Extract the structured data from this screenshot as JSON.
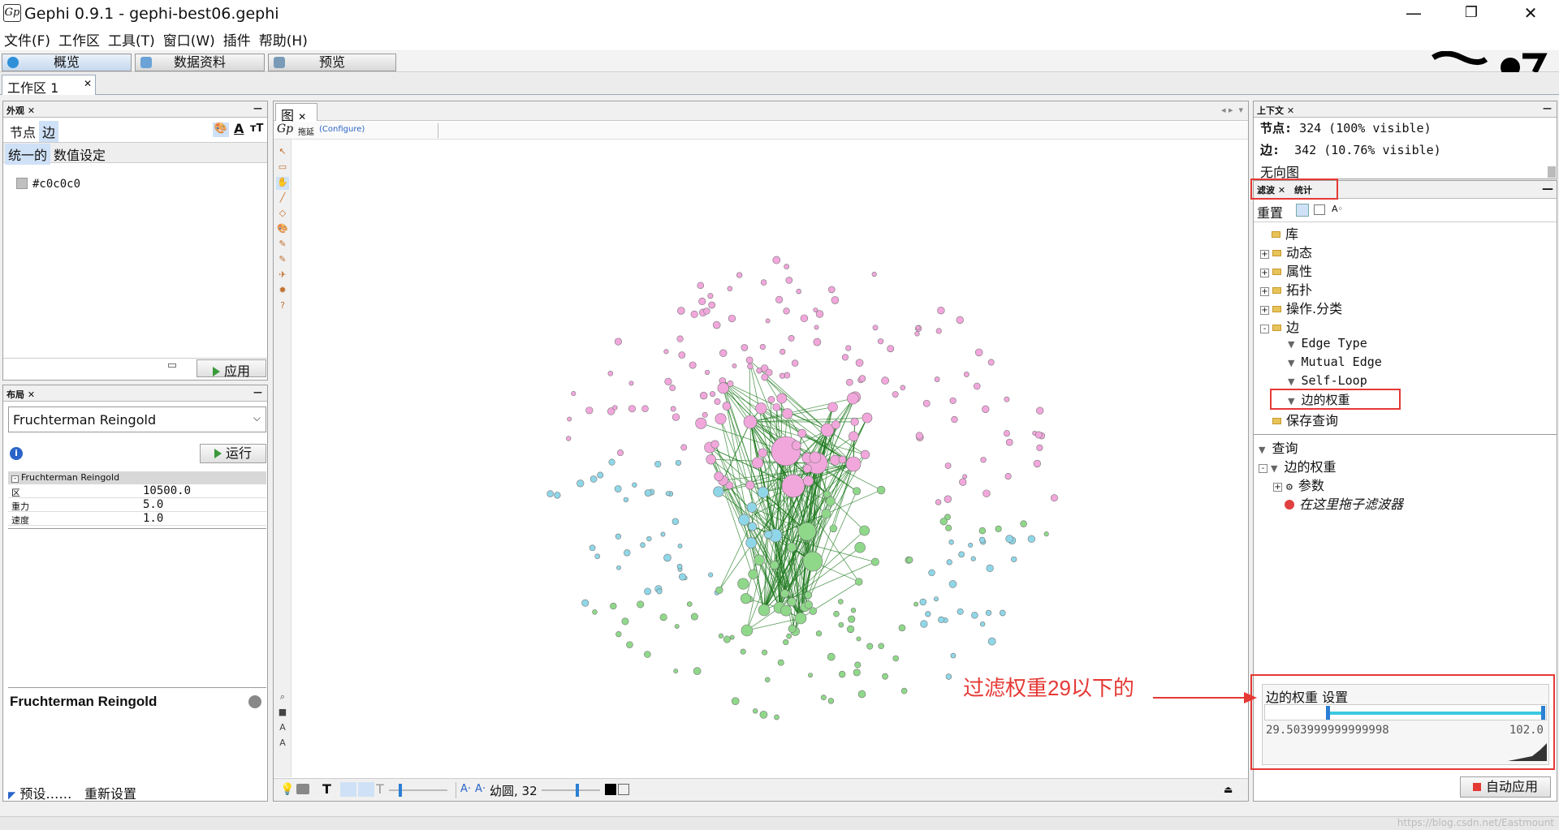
{
  "window": {
    "title": "Gephi 0.9.1 - gephi-best06.gephi",
    "app_icon": "Gp",
    "min_icon": "—",
    "max_icon": "❐",
    "close_icon": "✕"
  },
  "menu": [
    "文件(F)",
    "工作区",
    "工具(T)",
    "窗口(W)",
    "插件",
    "帮助(H)"
  ],
  "modes": [
    "概览",
    "数据资料",
    "预览"
  ],
  "workspace_tab": {
    "label": "工作区 1",
    "close": "✕"
  },
  "appearance": {
    "panel_title": "外观",
    "close": "✕",
    "min": "—",
    "tabs": [
      "节点",
      "边"
    ],
    "mode_tabs": [
      "统一的",
      "数值设定"
    ],
    "color_value": "#c0c0c0",
    "apply_label": "应用"
  },
  "layout_panel": {
    "panel_title": "布局",
    "algorithm": "Fruchterman Reingold",
    "run_label": "运行",
    "info_icon": "i",
    "section_title": "Fruchterman Reingold",
    "properties": [
      {
        "key": "区",
        "value": "10500.0"
      },
      {
        "key": "重力",
        "value": "5.0"
      },
      {
        "key": "速度",
        "value": "1.0"
      }
    ],
    "desc_title": "Fruchterman Reingold",
    "presets_label": "预设……",
    "reset_label": "重新设置"
  },
  "graph_panel": {
    "tab_label": "图",
    "drag_label": "拖延",
    "configure_label": "(Configure)",
    "bottom": {
      "font_name": "幼圆, 32",
      "font_a": "A·",
      "font_a2": "A·"
    }
  },
  "context": {
    "panel_title": "上下文",
    "nodes_label": "节点:",
    "nodes_value": "324 (100% visible)",
    "edges_label": "边:",
    "edges_value": "342 (10.76% visible)",
    "graph_type": "无向图"
  },
  "filters": {
    "tab_filter": "滤波",
    "tab_stats": "统计",
    "reset_label": "重置",
    "tree": [
      {
        "label": "库",
        "level": 0,
        "kind": "folder"
      },
      {
        "label": "动态",
        "level": 1,
        "kind": "folder-plus"
      },
      {
        "label": "属性",
        "level": 1,
        "kind": "folder-plus"
      },
      {
        "label": "拓扑",
        "level": 1,
        "kind": "folder-plus"
      },
      {
        "label": "操作.分类",
        "level": 1,
        "kind": "folder-plus"
      },
      {
        "label": "边",
        "level": 1,
        "kind": "folder-minus"
      },
      {
        "label": "Edge Type",
        "level": 2,
        "kind": "filter"
      },
      {
        "label": "Mutual Edge",
        "level": 2,
        "kind": "filter"
      },
      {
        "label": "Self-Loop",
        "level": 2,
        "kind": "filter"
      },
      {
        "label": "边的权重",
        "level": 2,
        "kind": "filter"
      },
      {
        "label": "保存查询",
        "level": 1,
        "kind": "folder"
      }
    ],
    "queries_label": "查询",
    "query_name": "边的权重",
    "params_label": "参数",
    "drop_hint": "在这里拖子滤波器",
    "settings_title": "边的权重 设置",
    "range_min": "29.503999999999998",
    "range_max": "102.0",
    "slider_low_fraction": 0.22,
    "slider_high_fraction": 1.0,
    "auto_apply_label": "自动应用"
  },
  "annotation": {
    "text": "过滤权重29以下的",
    "color": "#e53935"
  },
  "watermark": "https://blog.csdn.net/Eastmount",
  "colors": {
    "pink": "#f2a7dc",
    "blue": "#8fd7e8",
    "green": "#8fd88a",
    "edge": "#1e7a1e",
    "accent": "#3cc8e0"
  }
}
